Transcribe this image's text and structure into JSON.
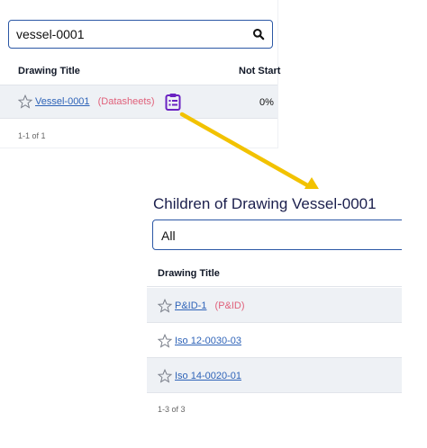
{
  "search": {
    "value": "vessel-0001"
  },
  "top_table": {
    "columns": [
      "Drawing Title",
      "Not Start"
    ],
    "rows": [
      {
        "title": "Vessel-0001",
        "type": "(Datasheets)",
        "not_started": "0%"
      }
    ],
    "pager": "1-1 of 1"
  },
  "children": {
    "title": "Children of Drawing Vessel-0001",
    "filter_value": "All",
    "column": "Drawing Title",
    "rows": [
      {
        "title": "P&ID-1",
        "type": "(P&ID)"
      },
      {
        "title": "Iso 12-0030-03",
        "type": ""
      },
      {
        "title": "Iso 14-0020-01",
        "type": ""
      }
    ],
    "pager": "1-3 of 3"
  },
  "colors": {
    "accent": "#2b57a5",
    "link": "#2e63b8",
    "tag": "#e0607a",
    "arrow": "#f2c200",
    "icon_purple": "#6b22c2"
  }
}
